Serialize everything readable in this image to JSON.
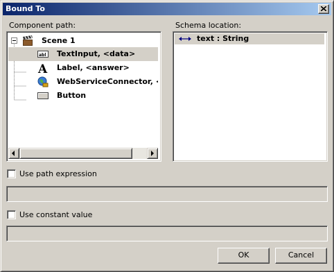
{
  "window": {
    "title": "Bound To"
  },
  "component_panel": {
    "label": "Component path:",
    "tree": {
      "root": {
        "label": "Scene 1",
        "expanded": true,
        "icon": "clapperboard-icon"
      },
      "children": [
        {
          "label": "TextInput, <data>",
          "icon": "textinput-icon",
          "selected": true
        },
        {
          "label": "Label, <answer>",
          "icon": "label-a-icon",
          "selected": false
        },
        {
          "label": "WebServiceConnector, <ws",
          "icon": "globe-connector-icon",
          "selected": false
        },
        {
          "label": "Button",
          "icon": "button-icon",
          "selected": false
        }
      ]
    }
  },
  "schema_panel": {
    "label": "Schema location:",
    "items": [
      {
        "label": "text : String",
        "icon": "bidirectional-arrow-icon",
        "selected": true
      }
    ]
  },
  "path_expression": {
    "label": "Use path expression",
    "checked": false,
    "value": ""
  },
  "constant_value": {
    "label": "Use constant value",
    "checked": false,
    "value": ""
  },
  "buttons": {
    "ok": "OK",
    "cancel": "Cancel"
  },
  "colors": {
    "titlebar_start": "#0a246a",
    "titlebar_end": "#a6caf0",
    "face": "#d4d0c8"
  }
}
